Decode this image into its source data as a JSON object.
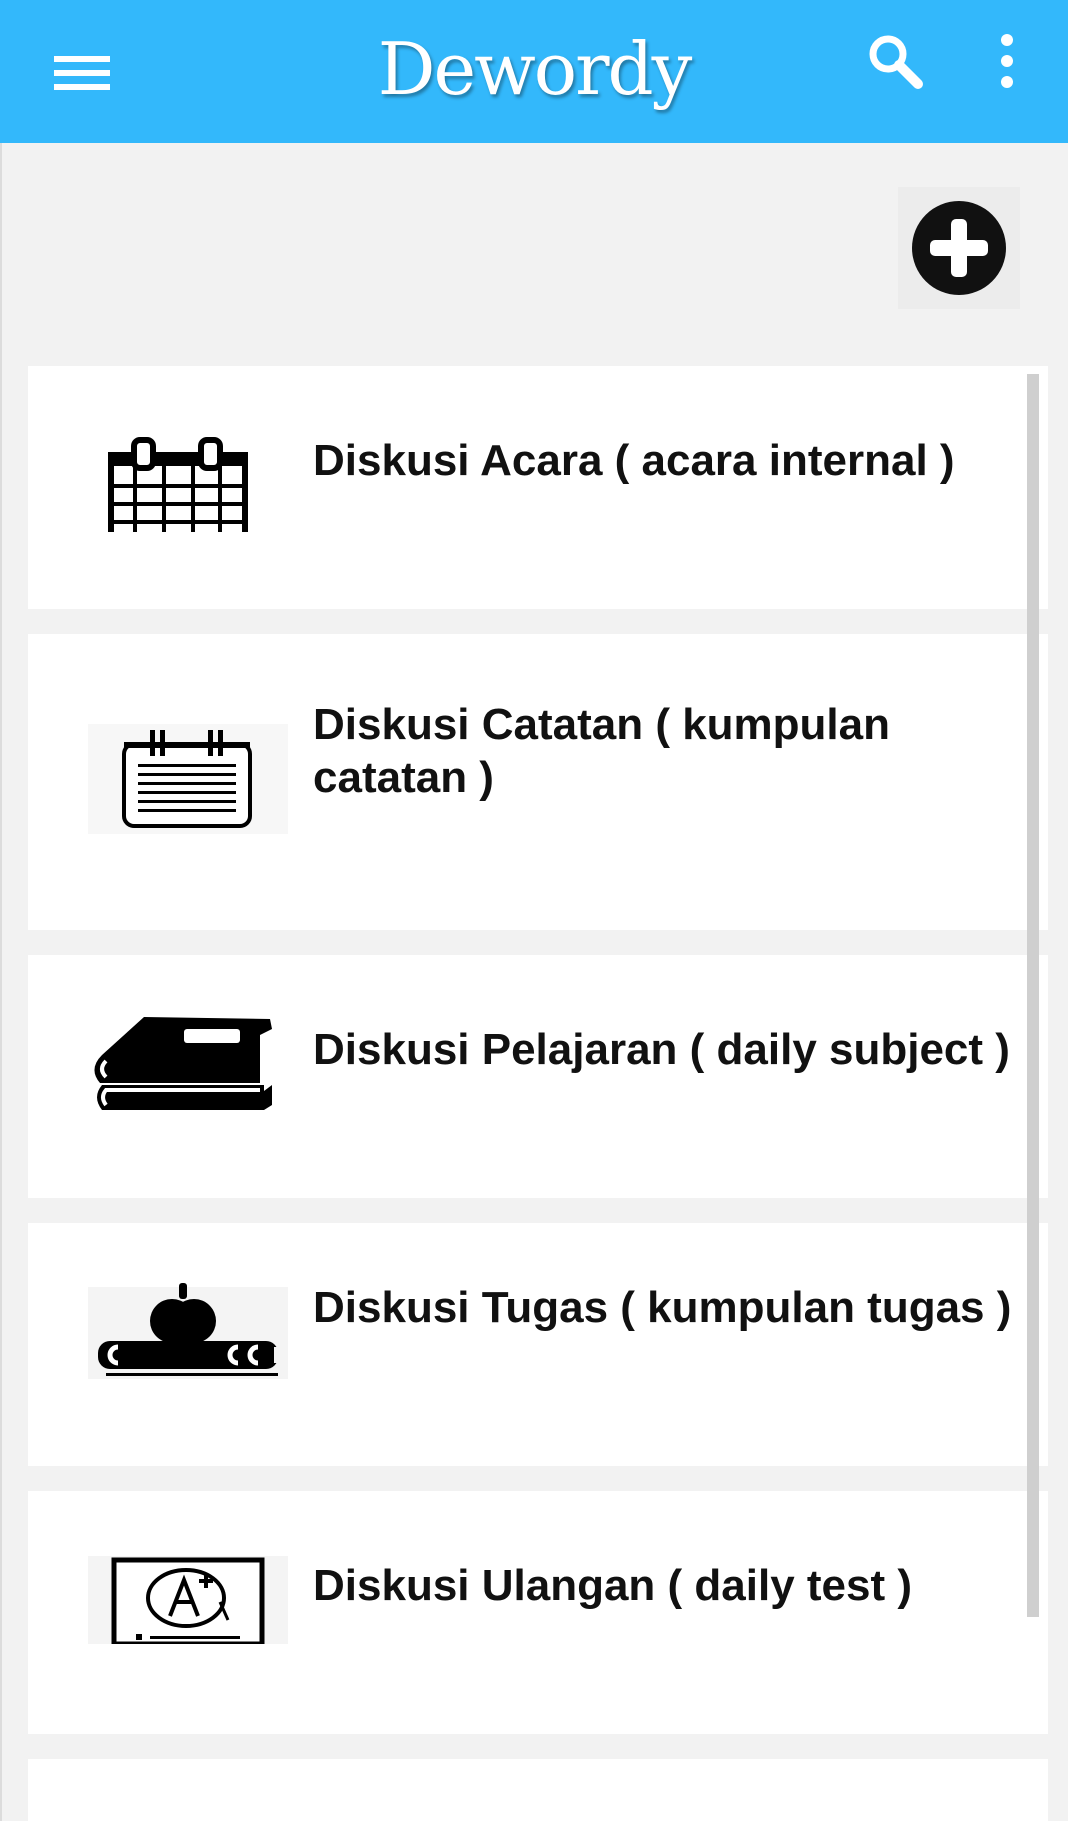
{
  "appbar": {
    "title": "Dewordy",
    "background": "#33b8fb",
    "icons": [
      "hamburger-menu-icon",
      "search-icon",
      "more-vertical-icon"
    ]
  },
  "actions": {
    "add_icon": "plus-circle-icon"
  },
  "discussions": [
    {
      "label": "Diskusi Acara ( acara internal )",
      "icon": "calendar-icon"
    },
    {
      "label": "Diskusi Catatan ( kumpulan catatan )",
      "icon": "notepad-icon"
    },
    {
      "label": "Diskusi Pelajaran ( daily subject )",
      "icon": "books-icon"
    },
    {
      "label": "Diskusi Tugas ( kumpulan tugas )",
      "icon": "apple-on-books-icon"
    },
    {
      "label": "Diskusi Ulangan ( daily test )",
      "icon": "graded-test-icon"
    }
  ]
}
